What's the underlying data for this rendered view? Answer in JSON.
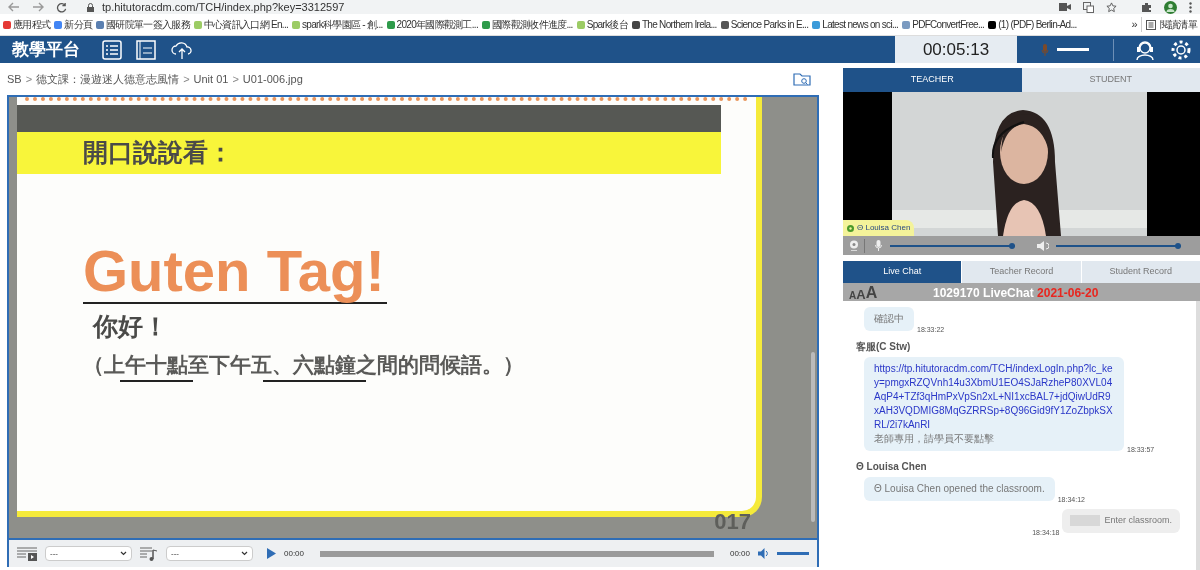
{
  "browser": {
    "url": "tp.hitutoracdm.com/TCH/index.php?key=3312597",
    "bookmarks": [
      "應用程式",
      "新分頁",
      "國研院單一簽入服務",
      "中心資訊入口網 En...",
      "spark科學園區 - 創...",
      "2020年國際觀測工...",
      "國際觀測收件進度...",
      "Spark後台",
      "The Northern Irela...",
      "Science Parks in E...",
      "Latest news on sci...",
      "PDFConvertFree...",
      "(1) (PDF) Berlin-Ad..."
    ],
    "more": "»",
    "reading_list": "閱讀清單"
  },
  "app_header": {
    "title": "教學平台",
    "timer": "00:05:13"
  },
  "breadcrumb": {
    "separator": ">",
    "items": [
      "SB",
      "德文課：漫遊迷人德意志風情",
      "Unit 01",
      "U01-006.jpg"
    ]
  },
  "slide": {
    "heading": "開口說說看：",
    "greeting": "Guten Tag!",
    "translation": "你好！",
    "note": "（上午十點至下午五、六點鐘之間的問候語。）",
    "page_number": "017"
  },
  "audio_bar": {
    "video_select": "---",
    "audio_select": "---",
    "time_start": "00:00",
    "time_end": "00:00",
    "progress": {
      "level": 0
    },
    "volume": {
      "level": 1
    }
  },
  "video_tabs": [
    {
      "label": "TEACHER",
      "selected": true
    },
    {
      "label": "STUDENT",
      "selected": false
    }
  ],
  "video": {
    "name_tag": "Θ Louisa Chen",
    "mic": {
      "level": 1
    },
    "speaker": {
      "level": 1
    }
  },
  "chat_tabs": [
    {
      "label": "Live Chat",
      "selected": true
    },
    {
      "label": "Teacher Record",
      "selected": false
    },
    {
      "label": "Student Record",
      "selected": false
    }
  ],
  "chat": {
    "font_sizes": [
      "A",
      "A",
      "A"
    ],
    "room": "1029170 LiveChat",
    "date": "2021-06-20",
    "messages": [
      {
        "kind": "received",
        "text": "確認中",
        "time": "18:33:22"
      },
      {
        "kind": "received",
        "sender": "客服(C Stw)",
        "link": "https://tp.hitutoracdm.com/TCH/indexLogIn.php?lc_key=pmgxRZQVnh14u3XbmU1EO4SJaRzheP80XVL04AqP4+TZf3qHmPxVpSn2xL+NI1xcBAL7+jdQiwUdR9xAH3VQDMIG8MqGZRRSp+8Q96Gid9fY1ZoZbpkSXRL/2i7kAnRI",
        "text": "老師專用，請學員不要點擊",
        "time": "18:33:57"
      },
      {
        "kind": "received",
        "sender": "Θ Louisa Chen",
        "text": "Θ Louisa Chen opened the classroom.",
        "time": "18:34:12"
      },
      {
        "kind": "sent",
        "text": "Enter classroom.",
        "time": "18:34:18"
      }
    ]
  }
}
